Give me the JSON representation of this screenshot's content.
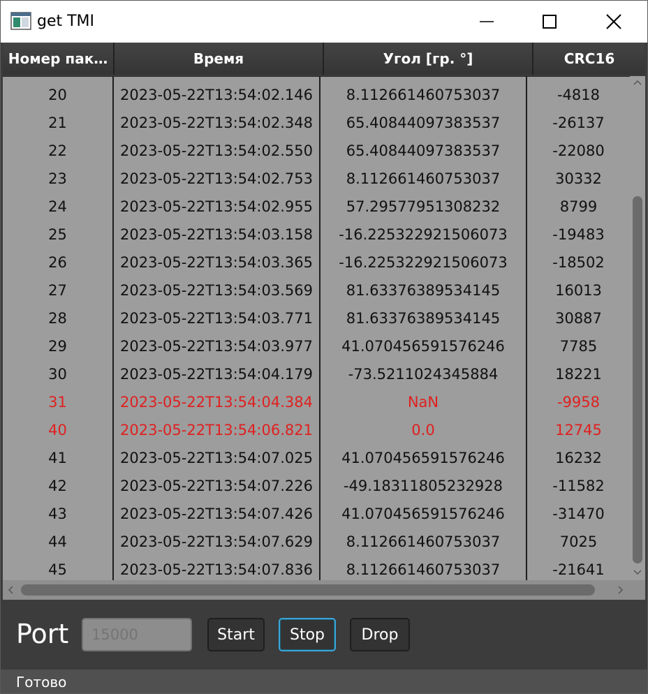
{
  "window": {
    "title": "get TMI",
    "icons": {
      "app": "app-window-icon",
      "minimize": "minimize-icon",
      "maximize": "maximize-icon",
      "close": "close-icon"
    }
  },
  "table": {
    "columns": [
      "Номер пак…",
      "Время",
      "Угол [гр. °]",
      "CRC16"
    ],
    "rows": [
      {
        "num": "20",
        "time": "2023-05-22T13:54:02.146",
        "angle": "8.11266146075303­7",
        "crc": "-4818",
        "error": false
      },
      {
        "num": "21",
        "time": "2023-05-22T13:54:02.348",
        "angle": "65.40844097383537",
        "crc": "-26137",
        "error": false
      },
      {
        "num": "22",
        "time": "2023-05-22T13:54:02.550",
        "angle": "65.40844097383537",
        "crc": "-22080",
        "error": false
      },
      {
        "num": "23",
        "time": "2023-05-22T13:54:02.753",
        "angle": "8.112661460753037",
        "crc": "30332",
        "error": false
      },
      {
        "num": "24",
        "time": "2023-05-22T13:54:02.955",
        "angle": "57.29577951308232",
        "crc": "8799",
        "error": false
      },
      {
        "num": "25",
        "time": "2023-05-22T13:54:03.158",
        "angle": "-16.225322921506073",
        "crc": "-19483",
        "error": false
      },
      {
        "num": "26",
        "time": "2023-05-22T13:54:03.365",
        "angle": "-16.225322921506073",
        "crc": "-18502",
        "error": false
      },
      {
        "num": "27",
        "time": "2023-05-22T13:54:03.569",
        "angle": "81.63376389534145",
        "crc": "16013",
        "error": false
      },
      {
        "num": "28",
        "time": "2023-05-22T13:54:03.771",
        "angle": "81.63376389534145",
        "crc": "30887",
        "error": false
      },
      {
        "num": "29",
        "time": "2023-05-22T13:54:03.977",
        "angle": "41.070456591576246",
        "crc": "7785",
        "error": false
      },
      {
        "num": "30",
        "time": "2023-05-22T13:54:04.179",
        "angle": "-73.5211024345884",
        "crc": "18221",
        "error": false
      },
      {
        "num": "31",
        "time": "2023-05-22T13:54:04.384",
        "angle": "NaN",
        "crc": "-9958",
        "error": true
      },
      {
        "num": "40",
        "time": "2023-05-22T13:54:06.821",
        "angle": "0.0",
        "crc": "12745",
        "error": true
      },
      {
        "num": "41",
        "time": "2023-05-22T13:54:07.025",
        "angle": "41.070456591576246",
        "crc": "16232",
        "error": false
      },
      {
        "num": "42",
        "time": "2023-05-22T13:54:07.226",
        "angle": "-49.18311805232928",
        "crc": "-11582",
        "error": false
      },
      {
        "num": "43",
        "time": "2023-05-22T13:54:07.426",
        "angle": "41.070456591576246",
        "crc": "-31470",
        "error": false
      },
      {
        "num": "44",
        "time": "2023-05-22T13:54:07.629",
        "angle": "8.112661460753037",
        "crc": "7025",
        "error": false
      },
      {
        "num": "45",
        "time": "2023-05-22T13:54:07.836",
        "angle": "8.112661460753037",
        "crc": "-21641",
        "error": false
      }
    ]
  },
  "controls": {
    "port_label": "Port",
    "port_placeholder": "15000",
    "port_value": "",
    "start_label": "Start",
    "stop_label": "Stop",
    "drop_label": "Drop"
  },
  "status": {
    "text": "Готово"
  },
  "colors": {
    "error_text": "#e02020",
    "focus_border": "#3aa6d6",
    "table_bg": "#9d9d9d",
    "window_bg": "#3c3c3c"
  }
}
